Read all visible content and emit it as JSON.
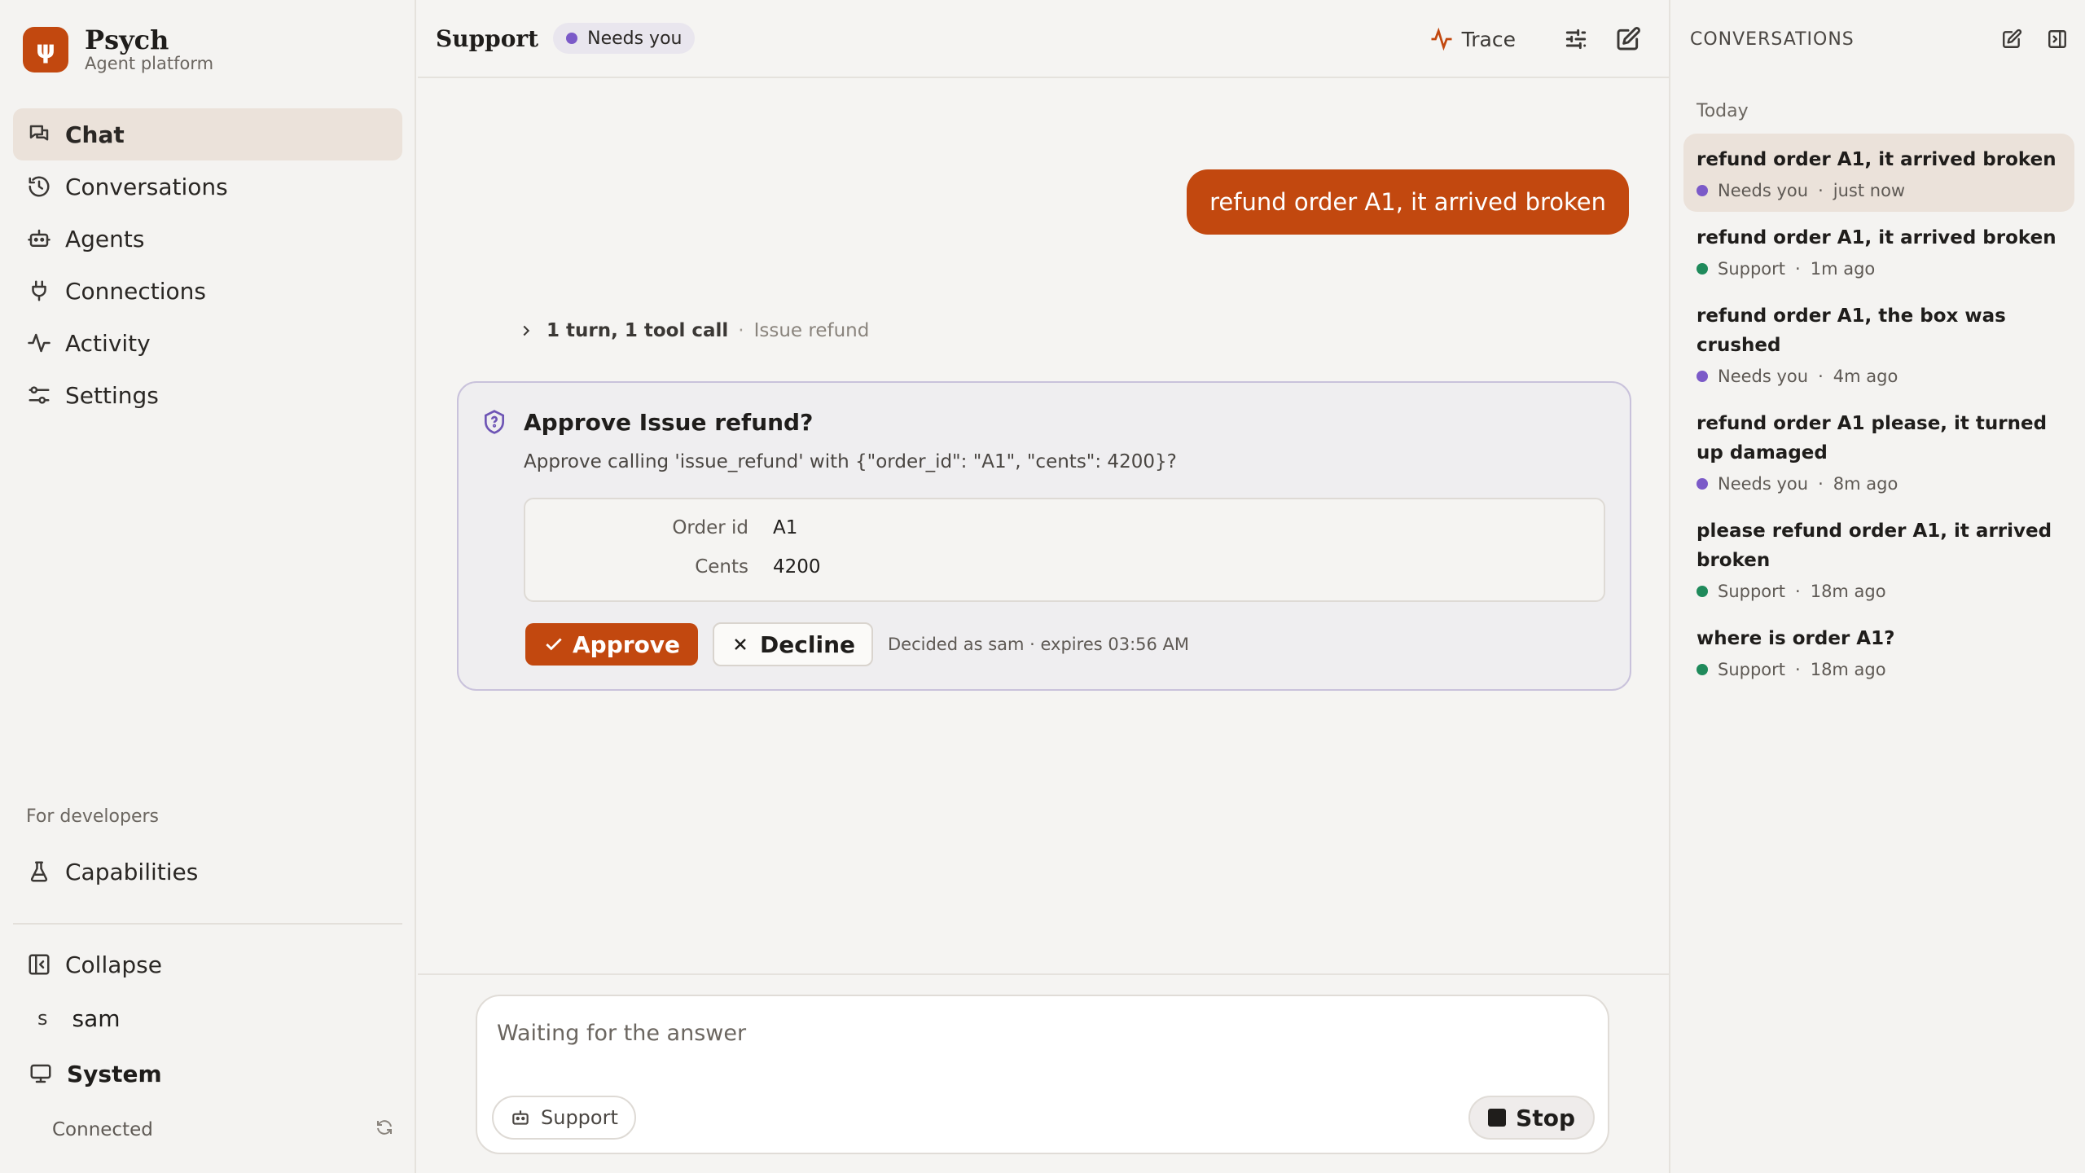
{
  "brand": {
    "name": "Psych",
    "subtitle": "Agent platform",
    "logo_glyph": "ψ"
  },
  "nav": {
    "items": [
      {
        "label": "Chat",
        "icon": "chat-icon",
        "active": true
      },
      {
        "label": "Conversations",
        "icon": "history-icon"
      },
      {
        "label": "Agents",
        "icon": "robot-icon"
      },
      {
        "label": "Connections",
        "icon": "plug-icon"
      },
      {
        "label": "Activity",
        "icon": "activity-icon"
      },
      {
        "label": "Settings",
        "icon": "sliders-icon"
      }
    ],
    "dev_label": "For developers",
    "dev_items": [
      {
        "label": "Capabilities",
        "icon": "flask-icon"
      }
    ],
    "collapse_label": "Collapse",
    "user_initial": "s",
    "user_name": "sam",
    "system_label": "System",
    "connection_status": "Connected"
  },
  "header": {
    "title": "Support",
    "badge": "Needs you",
    "trace_label": "Trace"
  },
  "chat": {
    "user_message": "refund order A1, it arrived broken",
    "turn_summary": "1 turn, 1 tool call",
    "turn_separator": "·",
    "turn_tool": "Issue refund"
  },
  "approval": {
    "title": "Approve Issue refund?",
    "description": "Approve calling 'issue_refund' with {\"order_id\": \"A1\", \"cents\": 4200}?",
    "fields": [
      {
        "key": "Order id",
        "value": "A1"
      },
      {
        "key": "Cents",
        "value": "4200"
      }
    ],
    "approve_label": "Approve",
    "decline_label": "Decline",
    "note": "Decided as sam · expires 03:56 AM"
  },
  "composer": {
    "placeholder": "Waiting for the answer",
    "agent_chip": "Support",
    "stop_label": "Stop"
  },
  "conversations": {
    "header": "CONVERSATIONS",
    "group": "Today",
    "items": [
      {
        "title": "refund order A1, it arrived broken",
        "status": "Needs you",
        "status_color": "#7b5ac8",
        "time": "just now",
        "active": true
      },
      {
        "title": "refund order A1, it arrived broken",
        "status": "Support",
        "status_color": "#1f8a5b",
        "time": "1m ago"
      },
      {
        "title": "refund order A1, the box was crushed",
        "status": "Needs you",
        "status_color": "#7b5ac8",
        "time": "4m ago"
      },
      {
        "title": "refund order A1 please, it turned up damaged",
        "status": "Needs you",
        "status_color": "#7b5ac8",
        "time": "8m ago"
      },
      {
        "title": "please refund order A1, it arrived broken",
        "status": "Support",
        "status_color": "#1f8a5b",
        "time": "18m ago"
      },
      {
        "title": "where is order A1?",
        "status": "Support",
        "status_color": "#1f8a5b",
        "time": "18m ago"
      }
    ],
    "meta_separator": "·"
  },
  "colors": {
    "accent": "#c2480f",
    "needs_you": "#7b5ac8",
    "support": "#1f8a5b"
  }
}
